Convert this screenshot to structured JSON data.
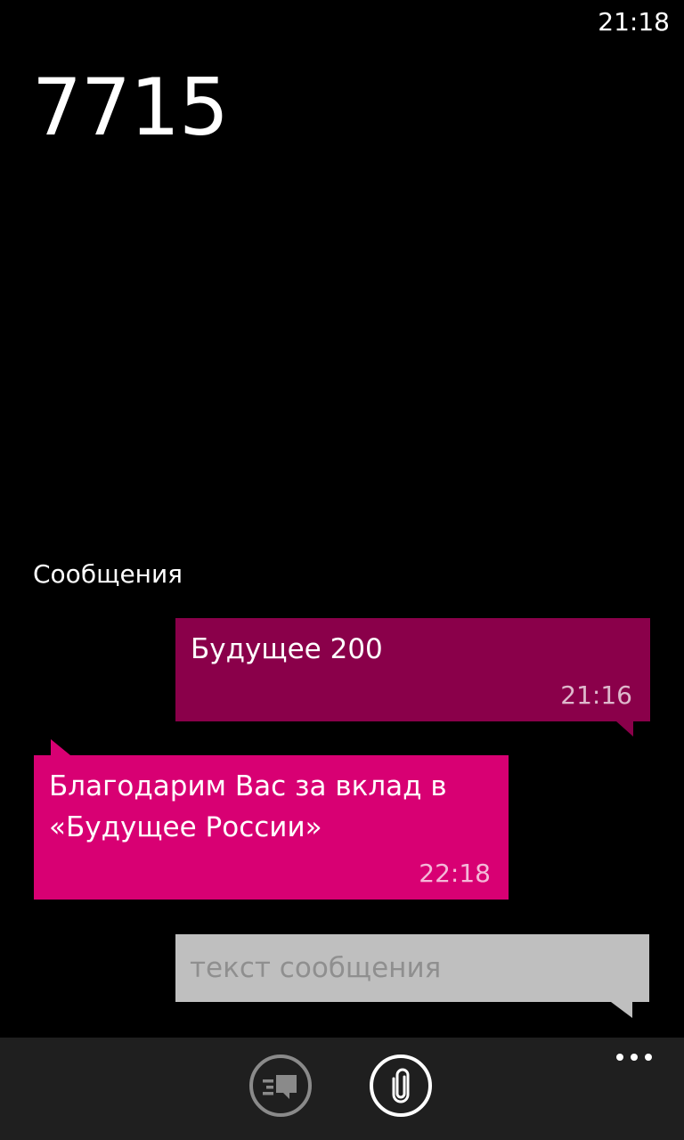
{
  "status_bar": {
    "time": "21:18"
  },
  "contact": {
    "title": "7715"
  },
  "section": {
    "label": "Сообщения"
  },
  "messages": [
    {
      "direction": "outgoing",
      "text": "Будущее 200",
      "time": "21:16",
      "color": "#8a004a"
    },
    {
      "direction": "incoming",
      "text": "Благодарим Вас за вклад в «Будущее России»",
      "time": "22:18",
      "color": "#d80073"
    }
  ],
  "composer": {
    "placeholder": "текст сообщения",
    "value": ""
  },
  "app_bar": {
    "buttons": [
      {
        "icon": "voice-to-text-icon"
      },
      {
        "icon": "attach-paperclip-icon"
      }
    ],
    "more_icon": "more-dots-icon"
  },
  "colors": {
    "accent": "#d80073",
    "accent_dark": "#8a004a",
    "compose_background": "#bfbfbf",
    "app_bar_background": "#1f1f1f"
  }
}
